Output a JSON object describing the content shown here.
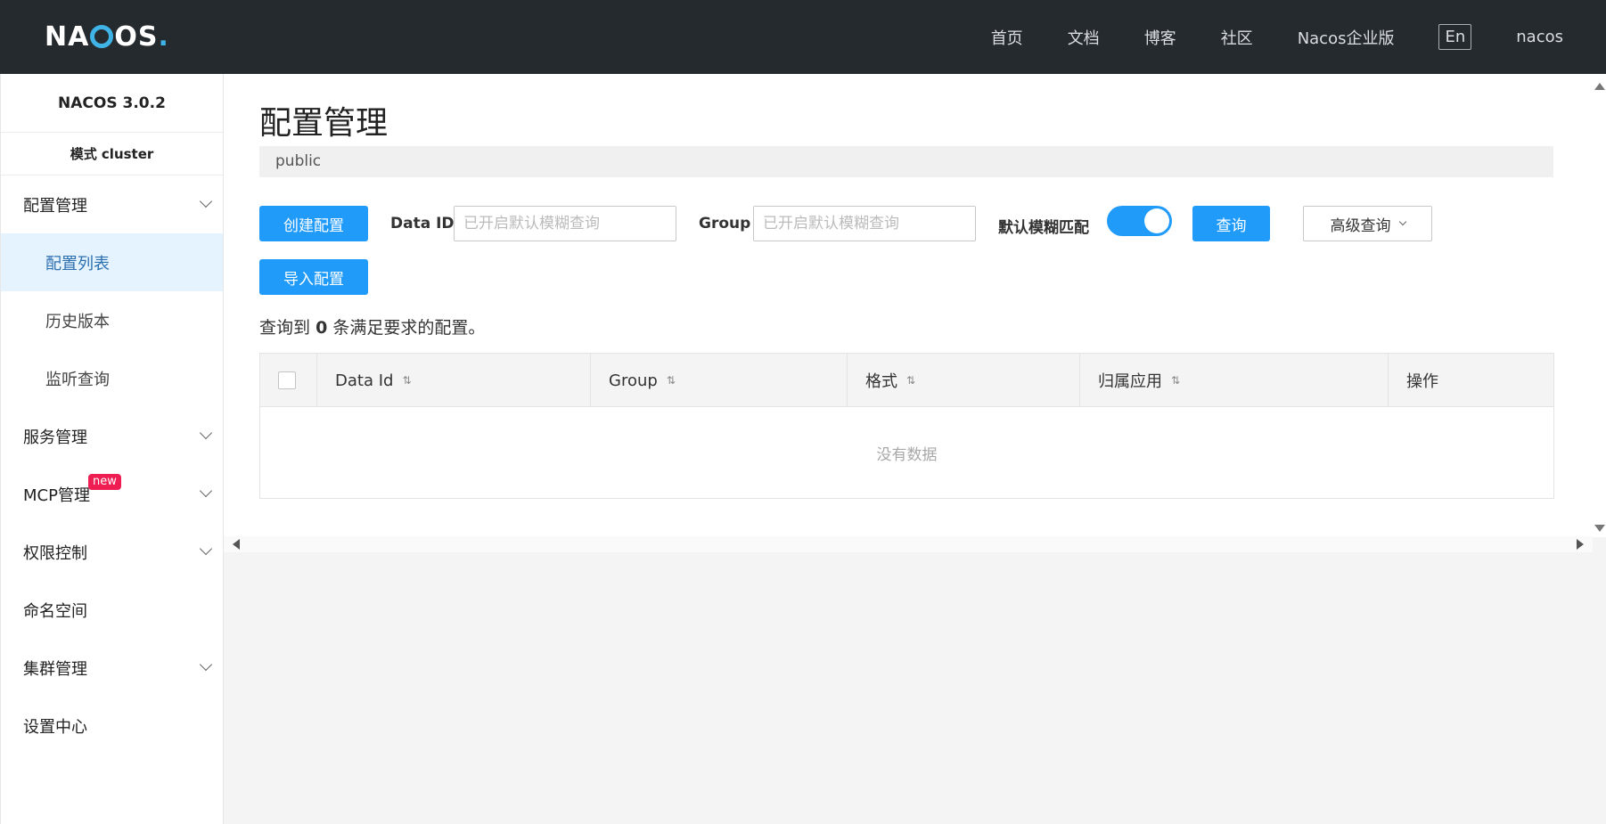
{
  "header": {
    "logo_left": "NA",
    "logo_right": "OS",
    "logo_dot": ".",
    "nav": [
      "首页",
      "文档",
      "博客",
      "社区",
      "Nacos企业版"
    ],
    "lang": "En",
    "user": "nacos"
  },
  "sidebar": {
    "version": "NACOS 3.0.2",
    "mode": "模式 cluster",
    "config_group": "配置管理",
    "config_items": [
      "配置列表",
      "历史版本",
      "监听查询"
    ],
    "service": "服务管理",
    "mcp": "MCP管理",
    "mcp_badge": "new",
    "auth": "权限控制",
    "namespace": "命名空间",
    "cluster": "集群管理",
    "settings": "设置中心"
  },
  "main": {
    "title": "配置管理",
    "namespace": "public",
    "create_btn": "创建配置",
    "dataid_label": "Data ID",
    "dataid_placeholder": "已开启默认模糊查询",
    "group_label": "Group",
    "group_placeholder": "已开启默认模糊查询",
    "fuzzy_label": "默认模糊匹配",
    "fuzzy_on": true,
    "query_btn": "查询",
    "advanced_btn": "高级查询",
    "import_btn": "导入配置",
    "result_prefix": "查询到",
    "result_count": "0",
    "result_suffix": "条满足要求的配置。",
    "columns": [
      "Data Id",
      "Group",
      "格式",
      "归属应用",
      "操作"
    ],
    "empty": "没有数据"
  },
  "colors": {
    "header_bg": "#252a2f",
    "accent": "#209bfa",
    "badge": "#ee1d52",
    "active_bg": "#e4f3fe"
  }
}
